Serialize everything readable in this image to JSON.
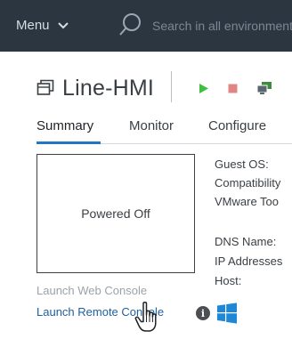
{
  "topbar": {
    "menu_label": "Menu",
    "search_placeholder": "Search in all environments"
  },
  "vm": {
    "name": "Line-HMI",
    "toolbar": {
      "power_on": "play-icon",
      "power_off": "stop-icon",
      "console": "console-icon"
    }
  },
  "tabs": [
    {
      "label": "Summary",
      "active": true
    },
    {
      "label": "Monitor",
      "active": false
    },
    {
      "label": "Configure",
      "active": false
    }
  ],
  "console_preview": {
    "status": "Powered Off"
  },
  "actions": {
    "web_console": "Launch Web Console",
    "remote_console": "Launch Remote Console"
  },
  "info": {
    "guest_os": "Guest OS:",
    "compatibility": "Compatibility",
    "vmware_tools": "VMware Too",
    "dns_name": "DNS Name:",
    "ip_addresses": "IP Addresses",
    "host": "Host:"
  },
  "colors": {
    "topbar": "#2c3640",
    "accent": "#1f78c1",
    "link": "#1f5fa0",
    "play": "#3fbf3f",
    "stop": "#e08585"
  }
}
